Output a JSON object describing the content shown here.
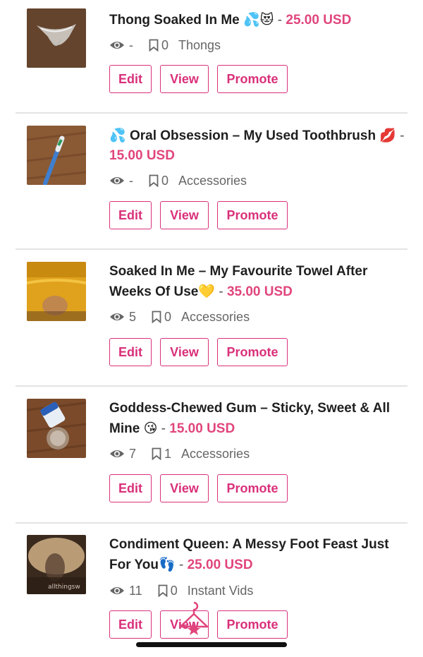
{
  "listings": [
    {
      "title": "Thong Soaked In Me",
      "emoji": "💦😻",
      "price": "25.00 USD",
      "views": "-",
      "saves": "0",
      "category": "Thongs",
      "edit_label": "Edit",
      "view_label": "View",
      "promote_label": "Promote"
    },
    {
      "title_prefix_emoji": "💦",
      "title": "Oral Obsession – My Used Toothbrush",
      "emoji": "💋",
      "price": "15.00 USD",
      "views": "-",
      "saves": "0",
      "category": "Accessories",
      "edit_label": "Edit",
      "view_label": "View",
      "promote_label": "Promote"
    },
    {
      "title": "Soaked In Me – My Favourite Towel After Weeks Of Use",
      "emoji": "💛",
      "price": "35.00 USD",
      "views": "5",
      "saves": "0",
      "category": "Accessories",
      "edit_label": "Edit",
      "view_label": "View",
      "promote_label": "Promote"
    },
    {
      "title": "Goddess-Chewed Gum – Sticky, Sweet & All Mine",
      "emoji": "😘",
      "price": "15.00 USD",
      "views": "7",
      "saves": "1",
      "category": "Accessories",
      "edit_label": "Edit",
      "view_label": "View",
      "promote_label": "Promote"
    },
    {
      "title": "Condiment Queen: A Messy Foot Feast Just For You",
      "emoji": "👣",
      "price": "25.00 USD",
      "views": "11",
      "saves": "0",
      "category": "Instant Vids",
      "watermark": "allthingsw",
      "edit_label": "Edit",
      "view_label": "View",
      "promote_label": "Promote"
    }
  ],
  "separator": "-",
  "colors": {
    "accent": "#d9307a",
    "price": "#e0457b",
    "divider": "#e3e3e3"
  }
}
